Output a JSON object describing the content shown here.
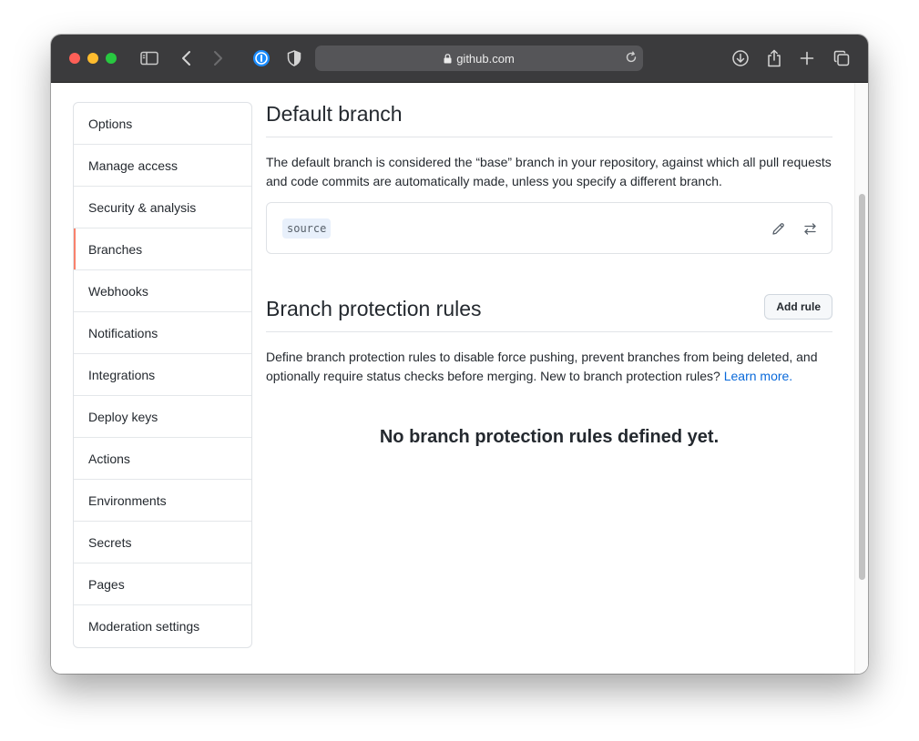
{
  "browser": {
    "url": "github.com",
    "icons": [
      "sidebar-toggle-icon",
      "back-icon",
      "forward-icon",
      "password-manager-icon",
      "privacy-shield-icon",
      "lock-icon",
      "reload-icon",
      "download-icon",
      "share-icon",
      "new-tab-icon",
      "tab-overview-icon"
    ]
  },
  "sidebar": {
    "items": [
      {
        "label": "Options"
      },
      {
        "label": "Manage access"
      },
      {
        "label": "Security & analysis"
      },
      {
        "label": "Branches"
      },
      {
        "label": "Webhooks"
      },
      {
        "label": "Notifications"
      },
      {
        "label": "Integrations"
      },
      {
        "label": "Deploy keys"
      },
      {
        "label": "Actions"
      },
      {
        "label": "Environments"
      },
      {
        "label": "Secrets"
      },
      {
        "label": "Pages"
      },
      {
        "label": "Moderation settings"
      }
    ],
    "active_item": "Branches",
    "accent_color": "#f9826c"
  },
  "default_branch": {
    "title": "Default branch",
    "description": "The default branch is considered the “base” branch in your repository, against which all pull requests and code commits are automatically made, unless you specify a different branch.",
    "branch_name": "source",
    "actions": [
      "pencil-icon",
      "switch-branch-icon"
    ]
  },
  "protection_rules": {
    "title": "Branch protection rules",
    "add_button_label": "Add rule",
    "description": "Define branch protection rules to disable force pushing, prevent branches from being deleted, and optionally require status checks before merging. New to branch protection rules?",
    "learn_more_label": "Learn more.",
    "empty_state": "No branch protection rules defined yet.",
    "link_color": "#0969da"
  }
}
